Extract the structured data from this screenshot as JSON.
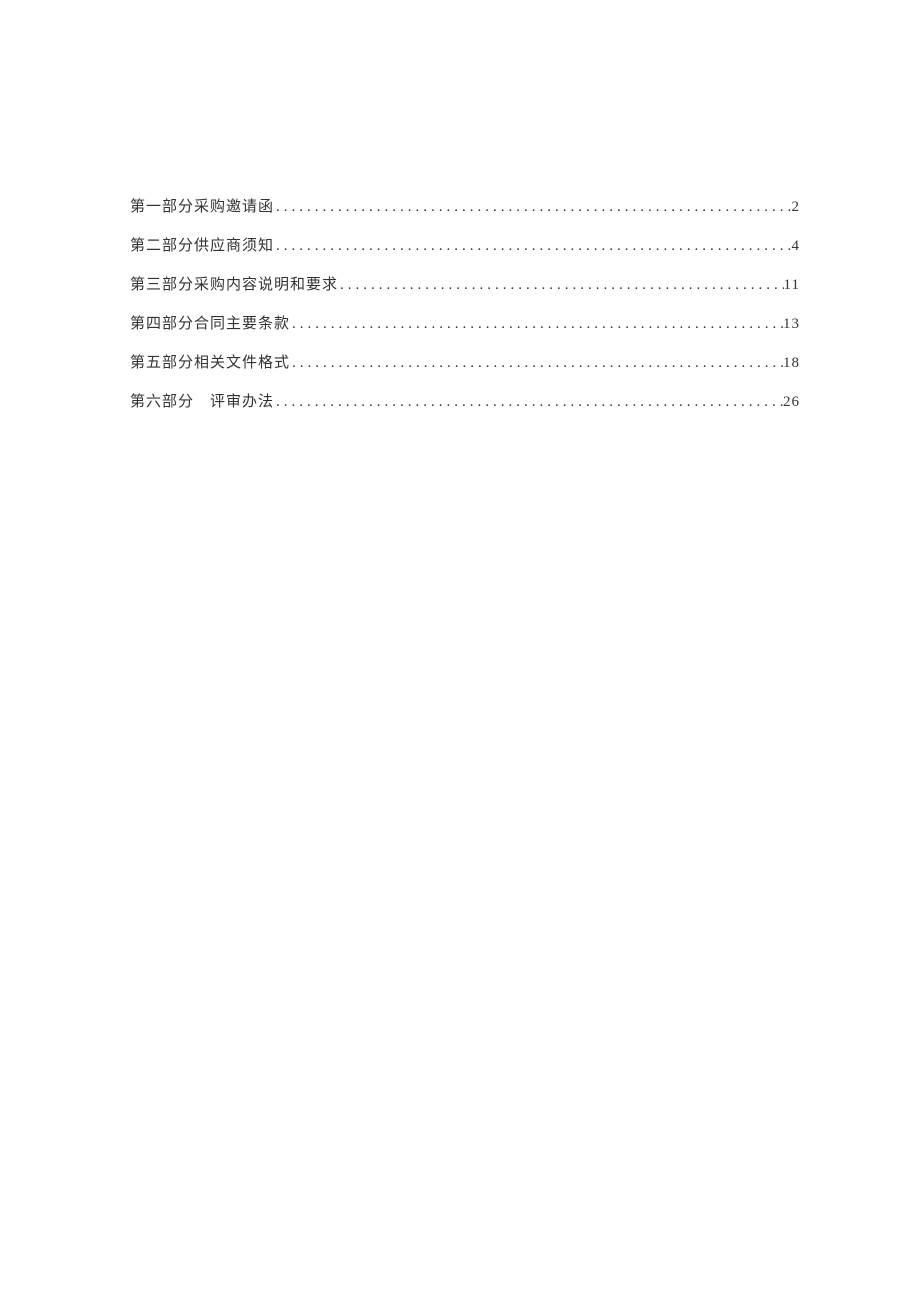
{
  "toc": {
    "entries": [
      {
        "label": "第一部分采购邀请函",
        "page": "2"
      },
      {
        "label": "第二部分供应商须知",
        "page": "4"
      },
      {
        "label": "第三部分采购内容说明和要求",
        "page": "11"
      },
      {
        "label": "第四部分合同主要条款",
        "page": "13"
      },
      {
        "label": "第五部分相关文件格式",
        "page": "18"
      },
      {
        "label": "第六部分　评审办法",
        "page": "26"
      }
    ]
  }
}
